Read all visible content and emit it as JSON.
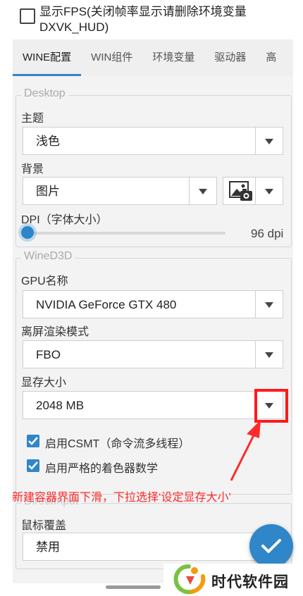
{
  "fps_option": {
    "label": "显示FPS(关闭帧率显示请删除环境变量 DXVK_HUD)",
    "checked": false
  },
  "tabs": [
    {
      "label": "WINE配置",
      "active": true
    },
    {
      "label": "WIN组件"
    },
    {
      "label": "环境变量"
    },
    {
      "label": "驱动器"
    },
    {
      "label": "高"
    }
  ],
  "desktop": {
    "section_title": "Desktop",
    "theme_label": "主题",
    "theme_value": "浅色",
    "background_label": "背景",
    "background_value": "图片",
    "dpi_label": "DPI（字体大小）",
    "dpi_value": "96 dpi",
    "dpi_slider_fraction": 0.0
  },
  "wined3d": {
    "section_title": "WineD3D",
    "gpu_label": "GPU名称",
    "gpu_value": "NVIDIA GeForce GTX 480",
    "offscreen_label": "离屏渲染模式",
    "offscreen_value": "FBO",
    "vram_label": "显存大小",
    "vram_value": "2048 MB",
    "csmt_label": "启用CSMT（命令流多线程）",
    "strict_shader_label": "启用严格的着色器数学"
  },
  "directinput": {
    "section_title": "DirectInput",
    "mouse_override_label": "鼠标覆盖",
    "mouse_override_value": "禁用"
  },
  "annotation": "新建容器界面下滑，下拉选择‘设定显存大小’",
  "watermark": "时代软件园",
  "colors": {
    "accent": "#2f86c9",
    "annotation_red": "#ff2a2a"
  },
  "icons": [
    "dropdown-arrow-icon",
    "image-icon",
    "check-icon"
  ]
}
